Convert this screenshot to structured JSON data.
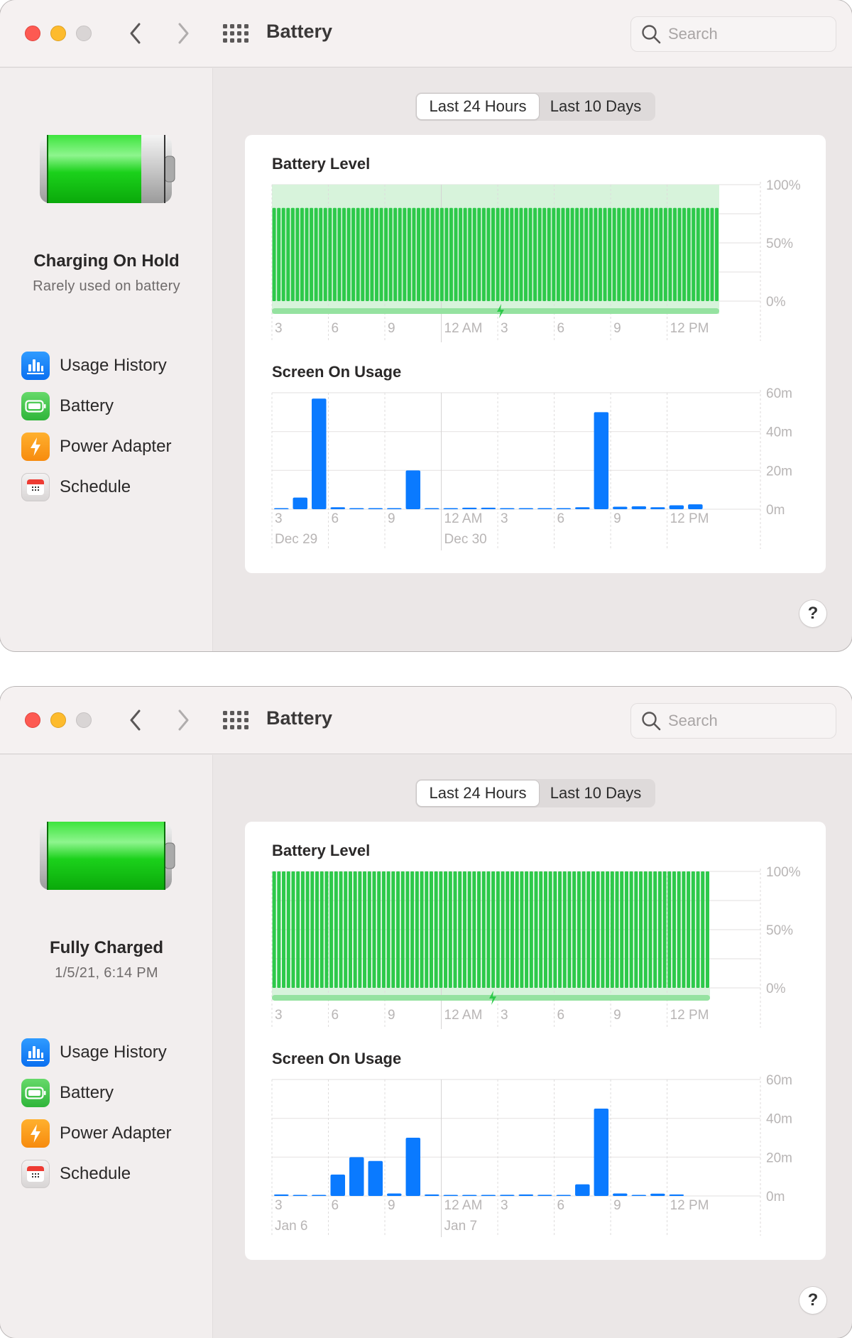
{
  "windows": [
    {
      "title": "Battery",
      "search_placeholder": "Search",
      "status": {
        "title": "Charging On Hold",
        "subtitle": "Rarely used on battery"
      },
      "sidebar": [
        {
          "label": "Usage History",
          "icon": "usage-history-icon",
          "active": true
        },
        {
          "label": "Battery",
          "icon": "battery-icon",
          "active": false
        },
        {
          "label": "Power Adapter",
          "icon": "power-adapter-icon",
          "active": false
        },
        {
          "label": "Schedule",
          "icon": "schedule-icon",
          "active": false
        }
      ],
      "tabs": [
        {
          "label": "Last 24 Hours",
          "selected": true
        },
        {
          "label": "Last 10 Days",
          "selected": false
        }
      ],
      "help_label": "?",
      "chart_data": [
        {
          "type": "bar",
          "title": "Battery Level",
          "x_tick_labels": [
            "3",
            "6",
            "9",
            "12 AM",
            "3",
            "6",
            "9",
            "12 PM"
          ],
          "y_tick_labels": [
            "100%",
            "50%",
            "0%"
          ],
          "ylim": [
            0,
            100
          ],
          "bar_count": 96,
          "values_note": "all intervals ~80% (charging on hold)",
          "value": 80,
          "charge_limit_band": [
            80,
            100
          ],
          "charging_indicator": {
            "label": "charging",
            "at_hour_index": 11.3
          },
          "colors": {
            "bar": "#2dc94a",
            "band": "#d7f3db",
            "charging_strip": "#95e2a0"
          }
        },
        {
          "type": "bar",
          "title": "Screen On Usage",
          "x_tick_labels": [
            "3",
            "6",
            "9",
            "12 AM",
            "3",
            "6",
            "9",
            "12 PM"
          ],
          "date_labels": [
            {
              "label": "Dec 29",
              "at_tick": 0
            },
            {
              "label": "Dec 30",
              "at_tick": 3
            }
          ],
          "y_tick_labels": [
            "60m",
            "40m",
            "20m",
            "0m"
          ],
          "ylim": [
            0,
            60
          ],
          "unit": "minutes",
          "values": [
            0.3,
            6,
            57,
            1,
            0.5,
            0.3,
            0.5,
            20,
            0,
            0.5,
            0.8,
            0.8,
            0.5,
            0.3,
            0.3,
            0.3,
            1,
            50,
            1.3,
            1.5,
            1,
            2,
            2.5
          ],
          "color": "#0a7aff"
        }
      ]
    },
    {
      "title": "Battery",
      "search_placeholder": "Search",
      "status": {
        "title": "Fully Charged",
        "subtitle": "1/5/21, 6:14 PM"
      },
      "sidebar": [
        {
          "label": "Usage History",
          "icon": "usage-history-icon",
          "active": true
        },
        {
          "label": "Battery",
          "icon": "battery-icon",
          "active": false
        },
        {
          "label": "Power Adapter",
          "icon": "power-adapter-icon",
          "active": false
        },
        {
          "label": "Schedule",
          "icon": "schedule-icon",
          "active": false
        }
      ],
      "tabs": [
        {
          "label": "Last 24 Hours",
          "selected": true
        },
        {
          "label": "Last 10 Days",
          "selected": false
        }
      ],
      "help_label": "?",
      "chart_data": [
        {
          "type": "bar",
          "title": "Battery Level",
          "x_tick_labels": [
            "3",
            "6",
            "9",
            "12 AM",
            "3",
            "6",
            "9",
            "12 PM"
          ],
          "y_tick_labels": [
            "100%",
            "50%",
            "0%"
          ],
          "ylim": [
            0,
            100
          ],
          "bar_count": 92,
          "values_note": "all intervals 100%",
          "value": 100,
          "charge_limit_band": null,
          "charging_indicator": {
            "label": "charging",
            "at_hour_index": 10.9
          },
          "colors": {
            "bar": "#2dc94a",
            "band": "#d7f3db",
            "charging_strip": "#95e2a0"
          }
        },
        {
          "type": "bar",
          "title": "Screen On Usage",
          "x_tick_labels": [
            "3",
            "6",
            "9",
            "12 AM",
            "3",
            "6",
            "9",
            "12 PM"
          ],
          "date_labels": [
            {
              "label": "Jan 6",
              "at_tick": 0
            },
            {
              "label": "Jan 7",
              "at_tick": 3
            }
          ],
          "y_tick_labels": [
            "60m",
            "40m",
            "20m",
            "0m"
          ],
          "ylim": [
            0,
            60
          ],
          "unit": "minutes",
          "values": [
            0.8,
            0.3,
            0.3,
            11,
            20,
            18,
            1.3,
            30,
            0.8,
            0.2,
            0.2,
            0.2,
            0.6,
            0.8,
            0.6,
            0.3,
            6,
            45,
            1.3,
            0.3,
            1.2,
            0.8
          ],
          "color": "#0a7aff"
        }
      ]
    }
  ]
}
